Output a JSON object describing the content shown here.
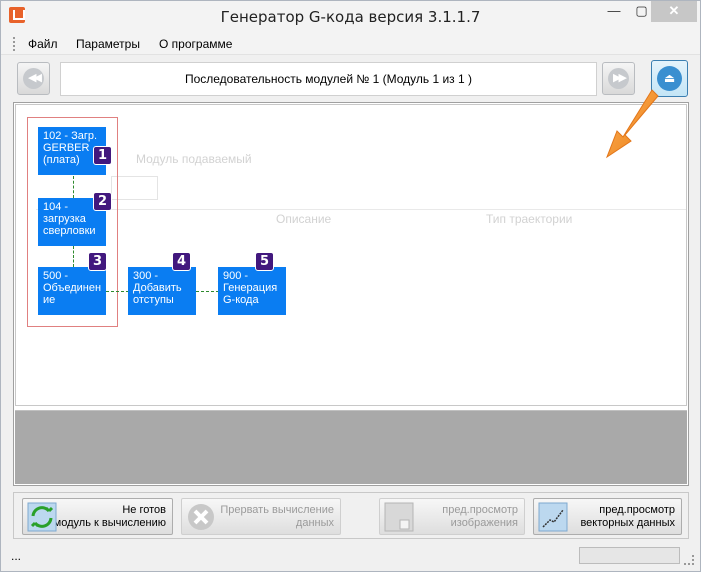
{
  "window": {
    "title": "Генератор G-кода версия 3.1.1.7",
    "controls": {
      "minimize": "—",
      "maximize": "▢",
      "close": "✕"
    }
  },
  "menu": {
    "items": [
      "Файл",
      "Параметры",
      "О программе"
    ]
  },
  "toolbar": {
    "prev_glyph": "◀◀",
    "next_glyph": "▶▶",
    "sequence_label": "Последовательность модулей № 1 (Модуль 1 из 1 )",
    "eject_glyph": "⏏"
  },
  "background_faded": {
    "text1": "Модуль подаваемый",
    "col_description": "Описание",
    "col_trajectory": "Тип траектории"
  },
  "modules": [
    {
      "label": "102 - Загр. GERBER (плата)",
      "badge": "1"
    },
    {
      "label": "104 - загрузка сверловки",
      "badge": "2"
    },
    {
      "label": "500 - Объединен ие",
      "badge": "3"
    },
    {
      "label": "300 - Добавить отступы",
      "badge": "4"
    },
    {
      "label": "900 - Генерация G-кода",
      "badge": "5"
    }
  ],
  "buttons": {
    "calc": {
      "line1": "Не готов",
      "line2": "модуль к вычислению"
    },
    "abort": {
      "line1": "Прервать вычисление",
      "line2": "данных"
    },
    "preview_image": {
      "line1": "пред.просмотр",
      "line2": "изображения"
    },
    "preview_vector": {
      "line1": "пред.просмотр",
      "line2": "векторных данных"
    }
  },
  "status": {
    "text": "...",
    "progress": 0
  },
  "colors": {
    "module_blue": "#0a7df2",
    "badge_purple": "#42187e",
    "arrow_orange": "#f28a1e",
    "group_frame_red": "#e08080",
    "connector_green": "#2e8a2e"
  }
}
